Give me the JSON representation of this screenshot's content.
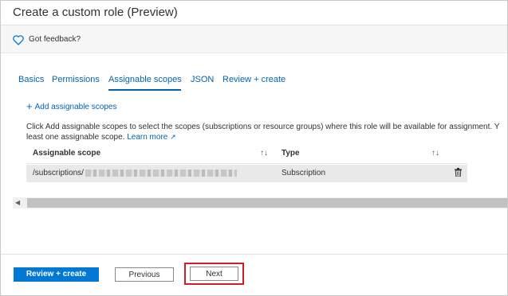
{
  "title": "Create a custom role (Preview)",
  "feedback": {
    "label": "Got feedback?",
    "icon": "heart-icon"
  },
  "tabs": [
    {
      "label": "Basics",
      "active": false
    },
    {
      "label": "Permissions",
      "active": false
    },
    {
      "label": "Assignable scopes",
      "active": true
    },
    {
      "label": "JSON",
      "active": false
    },
    {
      "label": "Review + create",
      "active": false
    }
  ],
  "add_scope": {
    "label": "Add assignable scopes",
    "icon": "plus-icon"
  },
  "info": {
    "line1": "Click Add assignable scopes to select the scopes (subscriptions or resource groups) where this role will be available for assignment. Y",
    "line2_prefix": "least one assignable scope.",
    "learn_more": "Learn more",
    "learn_more_icon": "external-link-icon"
  },
  "table": {
    "columns": [
      {
        "label": "Assignable scope",
        "sort_icon": "sort-icon"
      },
      {
        "label": "Type",
        "sort_icon": "sort-icon"
      }
    ],
    "rows": [
      {
        "scope_prefix": "/subscriptions/",
        "type": "Subscription",
        "action_icon": "trash-icon"
      }
    ]
  },
  "buttons": {
    "review_create": "Review + create",
    "previous": "Previous",
    "next": "Next"
  },
  "colors": {
    "accent": "#0078d4",
    "link": "#0063b1",
    "highlight_border": "#cc1d2b"
  }
}
